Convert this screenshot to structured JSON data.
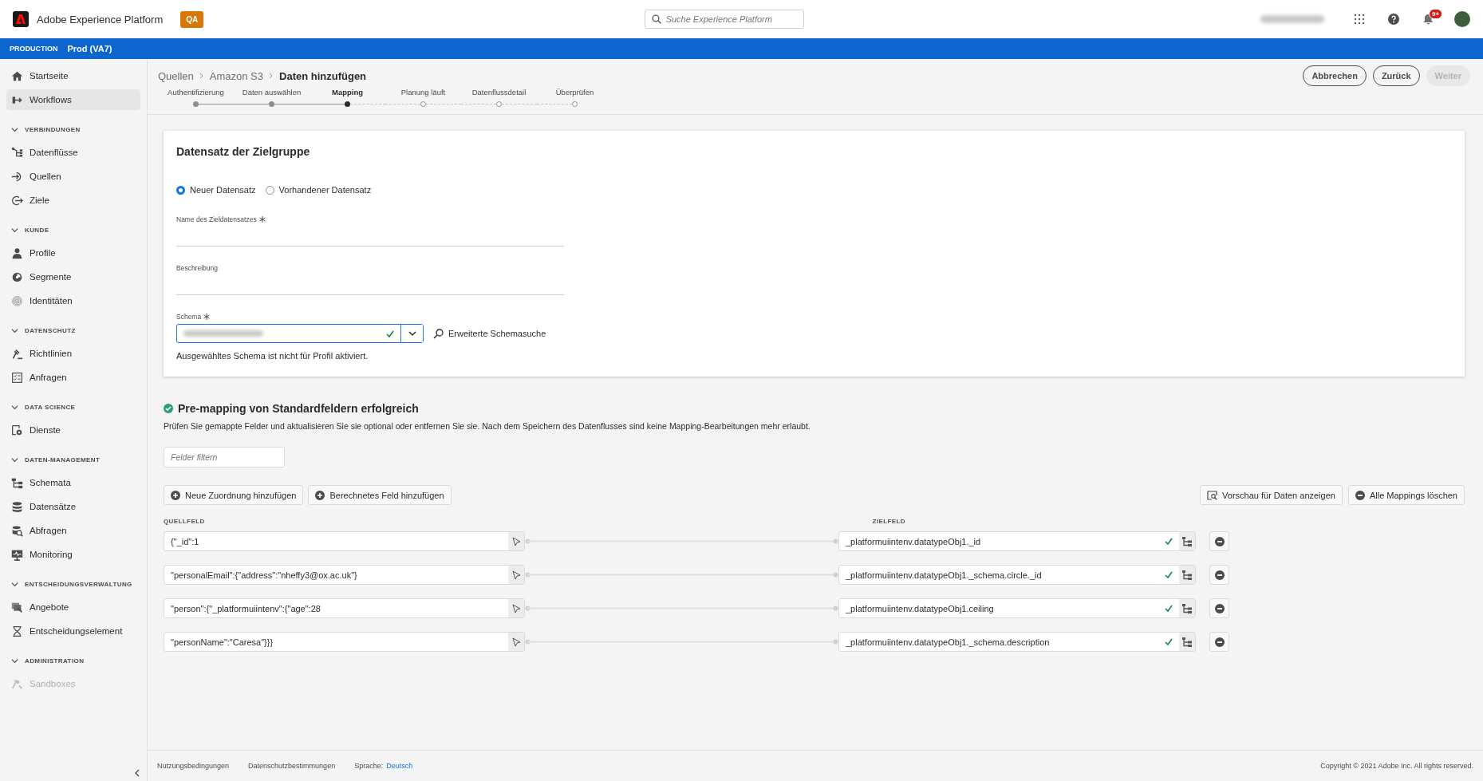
{
  "topbar": {
    "product": "Adobe Experience Platform",
    "env_badge": "QA",
    "search": {
      "placeholder": "Suche Experience Platform"
    },
    "notifications_badge": "9+"
  },
  "envbar": {
    "label": "PRODUCTION",
    "sandbox": "Prod (VA7)"
  },
  "sidebar": {
    "items": [
      {
        "label": "Startseite",
        "selected": false
      },
      {
        "label": "Workflows",
        "selected": true
      }
    ],
    "sections": [
      {
        "heading": "VERBINDUNGEN",
        "expanded": true,
        "items": [
          {
            "label": "Datenflüsse",
            "selected": false,
            "disabled": false
          },
          {
            "label": "Quellen",
            "selected": false,
            "disabled": false
          },
          {
            "label": "Ziele",
            "selected": false,
            "disabled": false
          }
        ]
      },
      {
        "heading": "KUNDE",
        "expanded": true,
        "items": [
          {
            "label": "Profile",
            "selected": false,
            "disabled": false
          },
          {
            "label": "Segmente",
            "selected": false,
            "disabled": false
          },
          {
            "label": "Identitäten",
            "selected": false,
            "disabled": false
          }
        ]
      },
      {
        "heading": "DATENSCHUTZ",
        "expanded": true,
        "items": [
          {
            "label": "Richtlinien",
            "selected": false,
            "disabled": false
          },
          {
            "label": "Anfragen",
            "selected": false,
            "disabled": false
          }
        ]
      },
      {
        "heading": "DATA SCIENCE",
        "expanded": true,
        "items": [
          {
            "label": "Dienste",
            "selected": false,
            "disabled": false
          }
        ]
      },
      {
        "heading": "DATEN-MANAGEMENT",
        "expanded": true,
        "items": [
          {
            "label": "Schemata",
            "selected": false,
            "disabled": false
          },
          {
            "label": "Datensätze",
            "selected": false,
            "disabled": false
          },
          {
            "label": "Abfragen",
            "selected": false,
            "disabled": false
          },
          {
            "label": "Monitoring",
            "selected": false,
            "disabled": false
          }
        ]
      },
      {
        "heading": "ENTSCHEIDUNGSVERWALTUNG",
        "expanded": true,
        "items": [
          {
            "label": "Angebote",
            "selected": false,
            "disabled": false
          },
          {
            "label": "Entscheidungselement",
            "selected": false,
            "disabled": false
          }
        ]
      },
      {
        "heading": "ADMINISTRATION",
        "expanded": true,
        "items": [
          {
            "label": "Sandboxes",
            "selected": false,
            "disabled": true
          }
        ]
      }
    ]
  },
  "breadcrumb": [
    {
      "label": "Quellen",
      "current": false
    },
    {
      "label": "Amazon S3",
      "current": false
    },
    {
      "label": "Daten hinzufügen",
      "current": true
    }
  ],
  "actions": [
    {
      "label": "Abbrechen",
      "disabled": false
    },
    {
      "label": "Zurück",
      "disabled": false
    },
    {
      "label": "Weiter",
      "disabled": true
    }
  ],
  "steps": [
    {
      "label": "Authentifizierung",
      "completed": true,
      "current": false
    },
    {
      "label": "Daten auswählen",
      "completed": true,
      "current": false
    },
    {
      "label": "Mapping",
      "completed": false,
      "current": true
    },
    {
      "label": "Planung läuft",
      "completed": false,
      "current": false
    },
    {
      "label": "Datenflussdetail",
      "completed": false,
      "current": false
    },
    {
      "label": "Überprüfen",
      "completed": false,
      "current": false
    }
  ],
  "dataset_card": {
    "title": "Datensatz der Zielgruppe",
    "options": [
      {
        "label": "Neuer Datensatz",
        "selected": true
      },
      {
        "label": "Vorhandener Datensatz",
        "selected": false
      }
    ],
    "fields": [
      {
        "label": "Name des Zieldatensatzes",
        "required": true
      },
      {
        "label": "Beschreibung",
        "required": false
      }
    ],
    "schema": {
      "label": "Schema",
      "required": true,
      "valid": true,
      "advanced_search": "Erweiterte Schemasuche",
      "note": "Ausgewähltes Schema ist nicht für Profil aktiviert."
    }
  },
  "mapping": {
    "status_title": "Pre-mapping von Standardfeldern erfolgreich",
    "description": "Prüfen Sie gemappte Felder und aktualisieren Sie sie optional oder entfernen Sie sie. Nach dem Speichern des Datenflusses sind keine Mapping-Bearbeitungen mehr erlaubt.",
    "filter": {
      "placeholder": "Felder filtern"
    },
    "left_buttons": [
      "Neue Zuordnung hinzufügen",
      "Berechnetes Feld hinzufügen"
    ],
    "right_buttons": [
      "Vorschau für Daten anzeigen",
      "Alle Mappings löschen"
    ],
    "source_heading": "QUELLFELD",
    "target_heading": "ZIELFELD",
    "rows": [
      {
        "source": "{\"_id\":1",
        "target": "_platformuiintenv.datatypeObj1._id",
        "valid": true
      },
      {
        "source": "\"personalEmail\":{\"address\":\"nheffy3@ox.ac.uk\"}",
        "target": "_platformuiintenv.datatypeObj1._schema.circle._id",
        "valid": true
      },
      {
        "source": "\"person\":{\"_platformuiintenv\":{\"age\":28",
        "target": "_platformuiintenv.datatypeObj1.ceiling",
        "valid": true
      },
      {
        "source": "\"personName\":\"Caresa\"}}}",
        "target": "_platformuiintenv.datatypeObj1._schema.description",
        "valid": true
      }
    ]
  },
  "footer": {
    "links": [
      "Nutzungsbedingungen",
      "Datenschutzbestimmungen"
    ],
    "language_label": "Sprache:",
    "language": "Deutsch",
    "copyright": "Copyright ©  2021 Adobe Inc.  All rights reserved."
  }
}
